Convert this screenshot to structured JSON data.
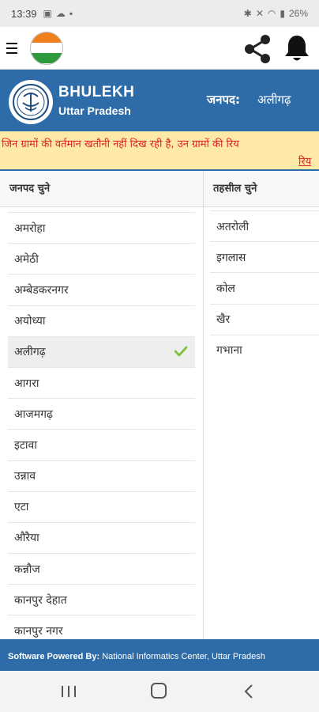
{
  "status_bar": {
    "time": "13:39",
    "battery": "26%"
  },
  "header": {
    "brand_title": "BHULEKH",
    "brand_subtitle": "Uttar Pradesh",
    "janpad_label": "जनपद:",
    "janpad_value": "अलीगढ़"
  },
  "marquee": {
    "line1": "जिन ग्रामों की वर्तमान खतौनी नहीं दिख रही है, उन ग्रामों की रिय",
    "line2": "रिय"
  },
  "janpad_column": {
    "header": "जनपद चुने",
    "items": [
      "अमरोहा",
      "अमेठी",
      "अम्बेडकरनगर",
      "अयोध्या",
      "अलीगढ़",
      "आगरा",
      "आजमगढ़",
      "इटावा",
      "उन्नाव",
      "एटा",
      "औरैया",
      "कन्नौज",
      "कानपुर देहात",
      "कानपुर नगर"
    ],
    "selected_index": 4
  },
  "tehsil_column": {
    "header": "तहसील चुने",
    "items": [
      "अतरोली",
      "इगलास",
      "कोल",
      "खैर",
      "गभाना"
    ]
  },
  "footer": {
    "prefix": "Software Powered By:",
    "text": " National Informatics Center, Uttar Pradesh"
  },
  "colors": {
    "primary": "#2d6ca8",
    "marquee_bg": "#ffe9a8",
    "marquee_text": "#dd2222",
    "check": "#7cc03c"
  }
}
